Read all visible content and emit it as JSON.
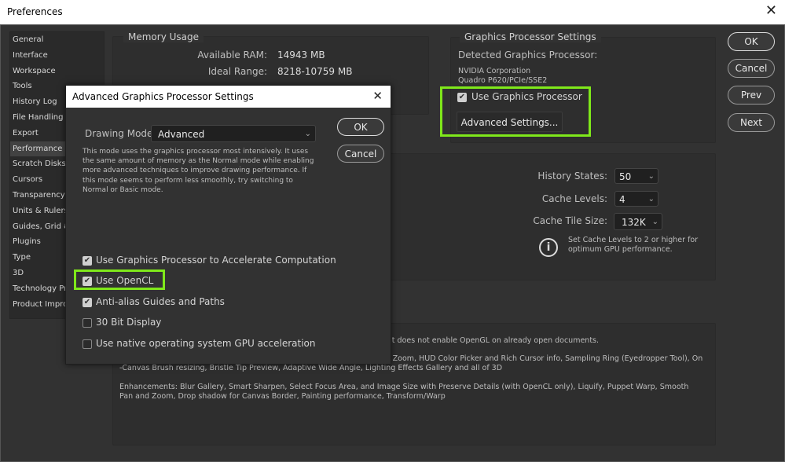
{
  "window": {
    "title": "Preferences",
    "close": "✕"
  },
  "sidebar": {
    "items": [
      "General",
      "Interface",
      "Workspace",
      "Tools",
      "History Log",
      "File Handling",
      "Export",
      "Performance",
      "Scratch Disks",
      "Cursors",
      "Transparency & Gamut",
      "Units & Rulers",
      "Guides, Grid & Slices",
      "Plugins",
      "Type",
      "3D",
      "Technology Previews",
      "Product Improvement"
    ],
    "selected": "Performance"
  },
  "memory": {
    "title": "Memory Usage",
    "available_label": "Available RAM:",
    "available_value": "14943 MB",
    "ideal_label": "Ideal Range:",
    "ideal_value": "8218-10759 MB"
  },
  "gpu": {
    "title": "Graphics Processor Settings",
    "detected_label": "Detected Graphics Processor:",
    "vendor": "NVIDIA Corporation",
    "model": "Quadro P620/PCIe/SSE2",
    "use_gpu_label": "Use Graphics Processor",
    "use_gpu_checked": true,
    "advanced_button": "Advanced Settings..."
  },
  "history": {
    "history_states_label": "History States:",
    "history_states": "50",
    "cache_levels_label": "Cache Levels:",
    "cache_levels": "4",
    "cache_tile_label": "Cache Tile Size:",
    "cache_tile": "132K",
    "info": "Set Cache Levels to 2 or higher for optimum GPU performance."
  },
  "description": {
    "line1": "s. It does not enable OpenGL on already open documents.",
    "line2a": "by Zoom, HUD Color Picker and Rich Cursor info, Sampling Ring (Eyedropper Tool), On",
    "line2b": "-Canvas Brush resizing, Bristle Tip Preview, Adaptive Wide Angle, Lighting Effects Gallery and all of 3D",
    "line3": "Enhancements: Blur Gallery, Smart Sharpen, Select Focus Area, and Image Size with Preserve Details (with OpenCL only), Liquify, Puppet Warp, Smooth Pan and Zoom, Drop shadow for Canvas Border, Painting performance, Transform/Warp"
  },
  "buttons": {
    "ok": "OK",
    "cancel": "Cancel",
    "prev": "Prev",
    "next": "Next"
  },
  "dialog": {
    "title": "Advanced Graphics Processor Settings",
    "close": "✕",
    "drawing_mode_label": "Drawing Mode:",
    "drawing_mode": "Advanced",
    "mode_description": "This mode uses the graphics processor most intensively.  It uses the same amount of memory as the Normal mode while enabling more advanced techniques to improve drawing performance.  If this mode seems to perform less smoothly, try switching to Normal or Basic mode.",
    "ok": "OK",
    "cancel": "Cancel",
    "options": [
      {
        "label": "Use Graphics Processor to Accelerate Computation",
        "checked": true
      },
      {
        "label": "Use OpenCL",
        "checked": true
      },
      {
        "label": "Anti-alias Guides and Paths",
        "checked": true
      },
      {
        "label": "30 Bit Display",
        "checked": false
      },
      {
        "label": "Use native operating system GPU acceleration",
        "checked": false
      }
    ]
  },
  "colors": {
    "highlight": "#7fe81a",
    "background": "#323232"
  }
}
